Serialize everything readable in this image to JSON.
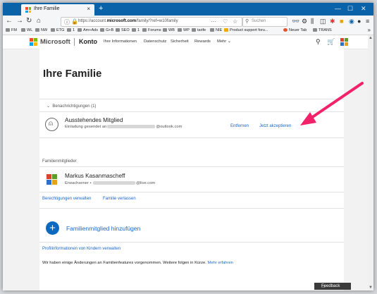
{
  "browser": {
    "tab_title": "Ihre Familie",
    "tab_close": "×",
    "new_tab": "+",
    "window_controls": [
      "—",
      "☐",
      "✕"
    ],
    "nav": {
      "back": "←",
      "forward": "→",
      "reload": "↻",
      "home": "⌂"
    },
    "url_prefix": "https://account.",
    "url_domain": "microsoft.com",
    "url_suffix": "/family/?ref=w10family",
    "url_actions": [
      "···",
      "♡",
      "☆"
    ],
    "search_placeholder": "Suchen",
    "bookmarks": [
      "FM",
      "WL",
      "NW",
      "ETG",
      "1",
      "Am+Ads",
      "G+B",
      "SEO",
      "1",
      "Forums",
      "WB",
      "WP",
      "tarife",
      "NIE",
      "Product support foru...",
      "Neuer Tab",
      "TRANS"
    ],
    "bookmarks_more": "»"
  },
  "header": {
    "brand": "Microsoft",
    "section": "Konto",
    "nav": [
      "Ihre Informationen",
      "Datenschutz",
      "Sicherheit",
      "Rewards",
      "Mehr ⌄"
    ]
  },
  "page": {
    "title": "Ihre Familie",
    "notifications_header": "Benachrichtigungen (1)",
    "pending": {
      "title": "Ausstehendes Mitglied",
      "sub_prefix": "Einladung gesendet an",
      "sub_suffix": "@outlook.com",
      "remove": "Entfernen",
      "accept": "Jetzt akzeptieren"
    },
    "members_header": "Familienmitglieder",
    "member": {
      "name": "Markus Kasanmascheff",
      "role": "Erwachsener •",
      "email_suffix": "@live.com"
    },
    "member_links": [
      "Berechtigungen verwalten",
      "Familie verlassen"
    ],
    "add_member": "Familienmitglied hinzufügen",
    "add_symbol": "+",
    "profile_link": "Profilinformationen von Kindern verwalten",
    "changes_text": "Wir haben einige Änderungen an Familienfeatures vorgenommen. Weitere folgen in Kürze.",
    "changes_link": "Mehr erfahren",
    "feedback": "Feedback"
  },
  "colors": {
    "accent": "#1a66c9",
    "tabbar": "#0a63a8",
    "arrow": "#f2216a"
  }
}
